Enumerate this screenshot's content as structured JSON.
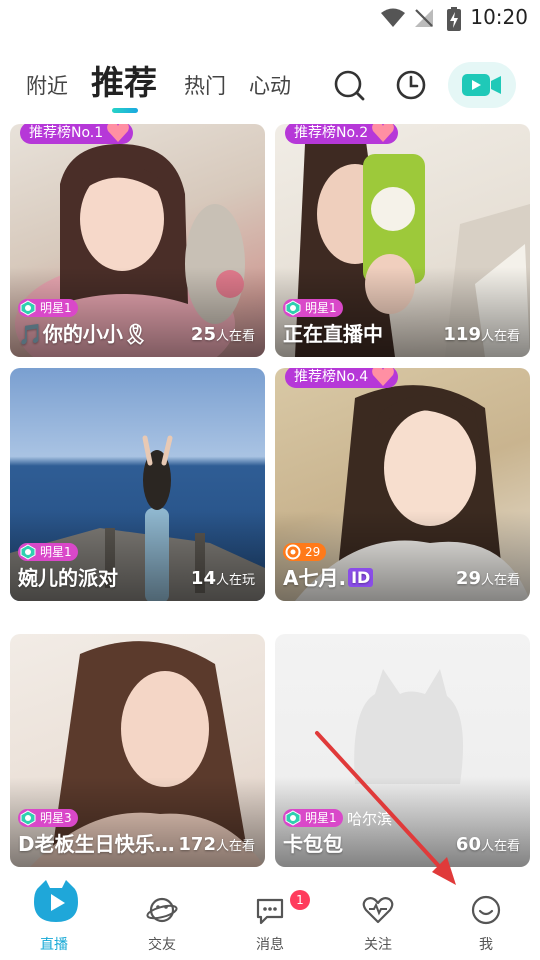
{
  "status_bar": {
    "time": "10:20"
  },
  "tabs": [
    {
      "label": "附近",
      "active": false
    },
    {
      "label": "推荐",
      "active": true
    },
    {
      "label": "热门",
      "active": false
    },
    {
      "label": "心动",
      "active": false
    }
  ],
  "top_icons": [
    "search-icon",
    "history-clock-icon",
    "go-live-camera-icon"
  ],
  "cards": [
    {
      "rank": "推荐榜No.1",
      "level": "明星1",
      "title": "🎵你的小小🎗",
      "viewers_num": "25",
      "viewers_unit": "人在看"
    },
    {
      "rank": "推荐榜No.2",
      "level": "明星1",
      "title": "正在直播中",
      "viewers_num": "119",
      "viewers_unit": "人在看"
    },
    {
      "level": "明星1",
      "title": "婉儿的派对",
      "viewers_num": "14",
      "viewers_unit": "人在玩"
    },
    {
      "rank": "推荐榜No.4",
      "level": "29",
      "title": "A七月.",
      "title_tag": "ID",
      "viewers_num": "29",
      "viewers_unit": "人在看"
    },
    {
      "level": "明星3",
      "title": "D老板生日快乐…",
      "viewers_num": "172",
      "viewers_unit": "人在看"
    },
    {
      "level": "明星1",
      "location": "哈尔滨",
      "title": "卡包包",
      "viewers_num": "60",
      "viewers_unit": "人在看"
    }
  ],
  "bottom_nav": [
    {
      "label": "直播",
      "active": true
    },
    {
      "label": "交友",
      "active": false
    },
    {
      "label": "消息",
      "active": false,
      "badge": "1"
    },
    {
      "label": "关注",
      "active": false
    },
    {
      "label": "我",
      "active": false
    }
  ],
  "colors": {
    "accent": "#17a9d6",
    "rank_badge": "#b638d8",
    "level_badge": "#d948c9",
    "annotation_arrow": "#e03a3a"
  }
}
